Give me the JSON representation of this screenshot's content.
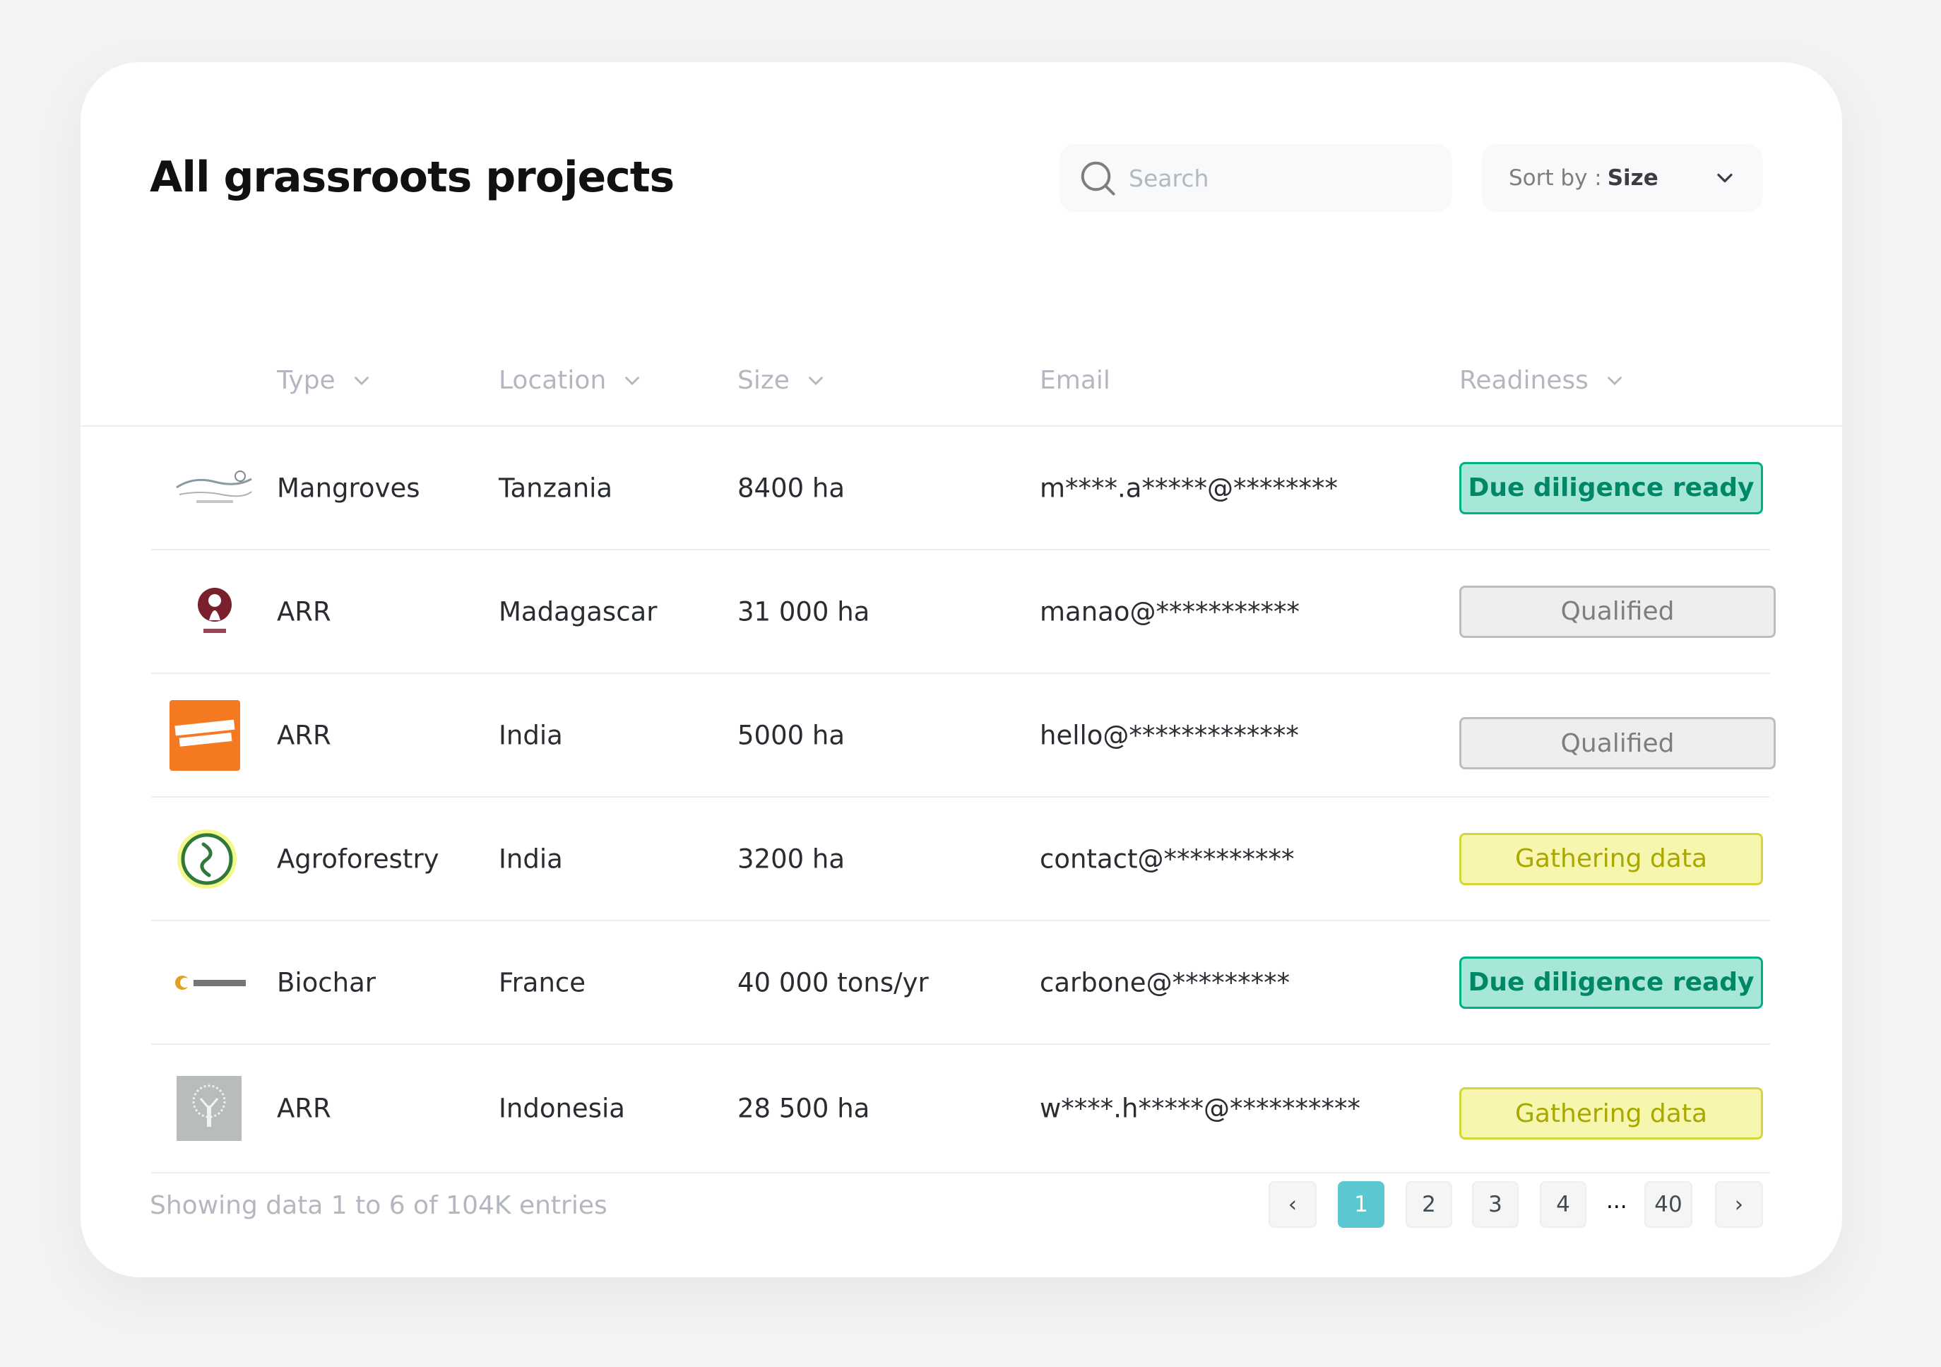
{
  "title": "All grassroots projects",
  "search": {
    "placeholder": "Search"
  },
  "sort": {
    "prefix": "Sort by :",
    "value": "Size"
  },
  "columns": {
    "type": "Type",
    "location": "Location",
    "size": "Size",
    "email": "Email",
    "readiness": "Readiness"
  },
  "rows": [
    {
      "type": "Mangroves",
      "location": "Tanzania",
      "size": "8400 ha",
      "email": "m****.a*****@********",
      "readiness": "Due diligence ready",
      "logo": "mangrove-org-logo"
    },
    {
      "type": "ARR",
      "location": "Madagascar",
      "size": "31 000 ha",
      "email": "manao@***********",
      "readiness": "Qualified",
      "logo": "baobab-org-logo"
    },
    {
      "type": "ARR",
      "location": "India",
      "size": "5000 ha",
      "email": "hello@*************",
      "readiness": "Qualified",
      "logo": "orange-org-logo"
    },
    {
      "type": "Agroforestry",
      "location": "India",
      "size": "3200 ha",
      "email": "contact@**********",
      "readiness": "Gathering data",
      "logo": "green-circle-logo"
    },
    {
      "type": "Biochar",
      "location": "France",
      "size": "40 000 tons/yr",
      "email": "carbone@*********",
      "readiness": "Due diligence ready",
      "logo": "biochar-org-logo"
    },
    {
      "type": "ARR",
      "location": "Indonesia",
      "size": "28 500 ha",
      "email": "w****.h*****@**********",
      "readiness": "Gathering data",
      "logo": "tree-org-logo"
    }
  ],
  "footer": {
    "showing": "Showing data 1 to 6 of  104K entries"
  },
  "pagination": {
    "prev": "‹",
    "pages": [
      "1",
      "2",
      "3",
      "4"
    ],
    "ellipsis": "...",
    "last": "40",
    "next": "›",
    "current": "1"
  },
  "colors": {
    "accent": "#5ac8d0",
    "ready_bg": "#a6e7d8",
    "ready_text": "#008767",
    "qualified_bg": "#eeeeee",
    "gathering_bg": "#f6f6ae"
  }
}
